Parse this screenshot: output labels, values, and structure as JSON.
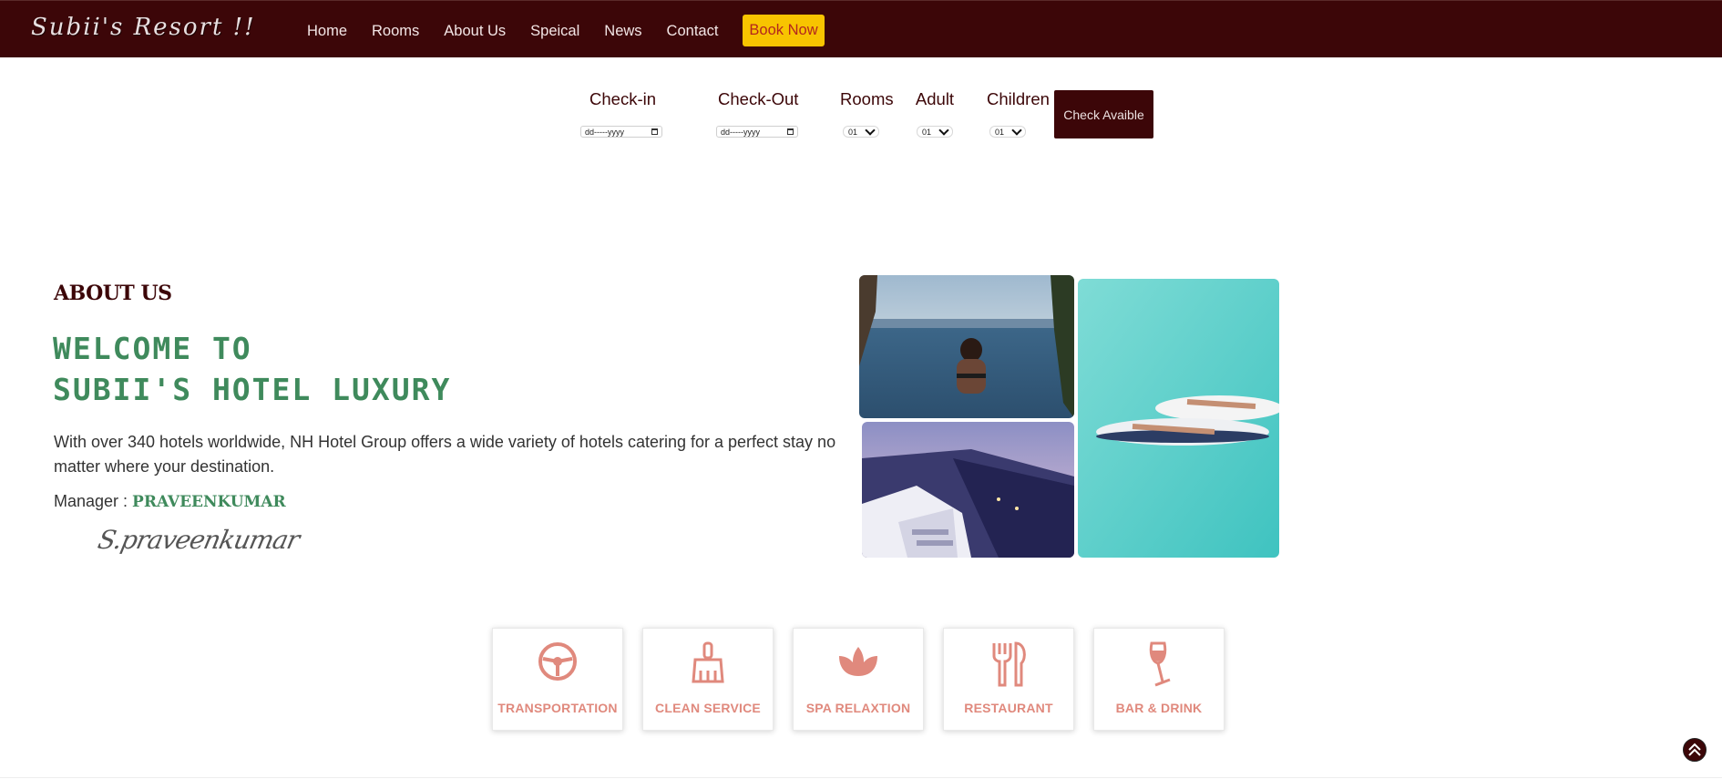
{
  "brand": "Subii's Resort !!",
  "nav": {
    "links": [
      "Home",
      "Rooms",
      "About Us",
      "Speical",
      "News",
      "Contact"
    ],
    "book_now": "Book Now"
  },
  "booking": {
    "checkin_label": "Check-in",
    "checkout_label": "Check-Out",
    "rooms_label": "Rooms",
    "adult_label": "Adult",
    "children_label": "Children",
    "date_placeholder": "dd-----yyyy",
    "rooms_value": "01",
    "adult_value": "01",
    "children_value": "01",
    "check_button": "Check Avaible"
  },
  "about": {
    "heading": "ABOUT US",
    "welcome_line1": "WELCOME TO",
    "welcome_line2": "SUBII'S HOTEL LUXURY",
    "description": "With over 340 hotels worldwide, NH Hotel Group offers a wide variety of hotels catering for a perfect stay no matter where your destination.",
    "manager_prefix": "Manager : ",
    "manager_name": "PRAVEENKUMAR",
    "signature": "S.praveenkumar"
  },
  "services": [
    {
      "label": "TRANSPORTATION",
      "icon": "steering-wheel-icon"
    },
    {
      "label": "CLEAN SERVICE",
      "icon": "brush-icon"
    },
    {
      "label": "SPA RELAXTION",
      "icon": "lotus-icon"
    },
    {
      "label": "RESTAURANT",
      "icon": "fork-spoon-icon"
    },
    {
      "label": "BAR & DRINK",
      "icon": "wine-glass-icon"
    }
  ],
  "colors": {
    "primary": "#3c0608",
    "accent_green": "#3f8a5c",
    "service_pink": "#e0897d",
    "book_yellow": "#f8c400"
  }
}
